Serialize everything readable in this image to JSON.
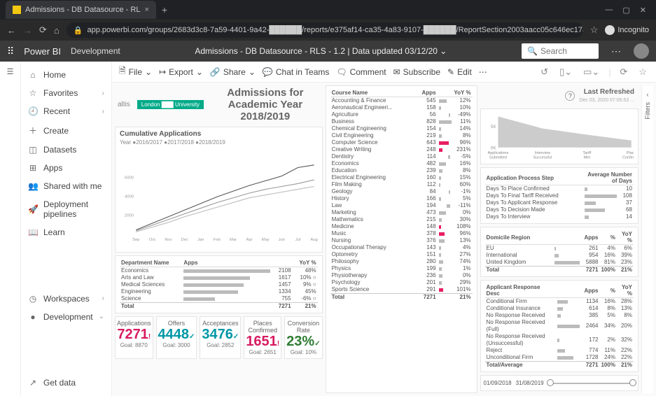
{
  "browser": {
    "tab_title": "Admissions - DB Datasource - RL",
    "url": "app.powerbi.com/groups/2683d3c8-7a59-4401-9a42-██████/reports/e375af14-ca35-4a83-9107-██████/ReportSection2003aacc05c646ec17aa",
    "incognito": "Incognito"
  },
  "pbi": {
    "brand": "Power BI",
    "env": "Development",
    "center": "Admissions - DB Datasource - RLS - 1.2  |  Data updated 03/12/20 ⌄",
    "search_ph": "Search"
  },
  "leftnav": {
    "home": "Home",
    "favorites": "Favorites",
    "recent": "Recent",
    "create": "Create",
    "datasets": "Datasets",
    "apps": "Apps",
    "shared": "Shared with me",
    "pipelines": "Deployment pipelines",
    "learn": "Learn",
    "workspaces": "Workspaces",
    "development": "Development",
    "getdata": "Get data"
  },
  "actionbar": {
    "file": "File",
    "export": "Export",
    "share": "Share",
    "chat": "Chat in Teams",
    "comment": "Comment",
    "subscribe": "Subscribe",
    "edit": "Edit"
  },
  "report": {
    "logo1": "altis",
    "logo2": "London ███ University",
    "title": "Admissions for Academic Year 2018/2019",
    "refresh_label": "Last Refreshed",
    "refresh_time": "Dec 03, 2020 07:05:53 ..."
  },
  "chart_data": {
    "cumulative": {
      "title": "Cumulative Applications",
      "legend": "Year  ●2016/2017  ●2017/2018  ●2018/2019",
      "type": "line",
      "categories": [
        "Sep",
        "Oct",
        "Nov",
        "Dec",
        "Jan",
        "Feb",
        "Mar",
        "Apr",
        "May",
        "Jun",
        "Jul",
        "Aug"
      ],
      "ylim": [
        0,
        8000
      ],
      "yticks": [
        2000,
        4000,
        6000
      ],
      "series": [
        {
          "name": "2016/2017",
          "values": [
            200,
            700,
            1200,
            1800,
            2300,
            2800,
            3300,
            3800,
            4100,
            4400,
            4700,
            5000
          ]
        },
        {
          "name": "2017/2018",
          "values": [
            300,
            900,
            1500,
            2100,
            2700,
            3300,
            3800,
            4300,
            4700,
            5000,
            5300,
            5700
          ]
        },
        {
          "name": "2018/2019",
          "values": [
            400,
            1100,
            1800,
            2500,
            3200,
            3900,
            4500,
            5100,
            5600,
            6100,
            7000,
            7271
          ]
        }
      ]
    },
    "funnel": {
      "type": "area",
      "categories": [
        "Applications Submitted",
        "Interview Successful",
        "Tariff Met",
        "Place Confirmed"
      ],
      "values": [
        7271,
        4448,
        3000,
        1651
      ],
      "yticks": [
        0,
        5000
      ],
      "yticklabels": [
        "0K",
        "5K"
      ]
    }
  },
  "dept": {
    "title": "Department Name",
    "col_apps": "Apps",
    "col_yoy": "YoY %",
    "rows": [
      {
        "name": "Economics",
        "apps": 2108,
        "yoy": "48%"
      },
      {
        "name": "Arts and Law",
        "apps": 1617,
        "yoy": "10% ○"
      },
      {
        "name": "Medical Sciences",
        "apps": 1457,
        "yoy": "9% ○"
      },
      {
        "name": "Engineering",
        "apps": 1334,
        "yoy": "45%"
      },
      {
        "name": "Science",
        "apps": 755,
        "yoy": "-6% ○"
      }
    ],
    "total": {
      "name": "Total",
      "apps": 7271,
      "yoy": "21%"
    }
  },
  "course": {
    "title": "Course Name",
    "col_apps": "Apps",
    "col_yoy": "YoY %",
    "rows": [
      {
        "name": "Accounting & Finance",
        "apps": 545,
        "yoy": "12%"
      },
      {
        "name": "Aeronautical Engineeri...",
        "apps": 158,
        "yoy": "10%"
      },
      {
        "name": "Agriculture",
        "apps": 56,
        "yoy": "-49%"
      },
      {
        "name": "Business",
        "apps": 828,
        "yoy": "11%"
      },
      {
        "name": "Chemical Engineering",
        "apps": 154,
        "yoy": "14%"
      },
      {
        "name": "Civil Engineering",
        "apps": 219,
        "yoy": "8%"
      },
      {
        "name": "Computer Science",
        "apps": 643,
        "yoy": "96%"
      },
      {
        "name": "Creative Writing",
        "apps": 248,
        "yoy": "231%"
      },
      {
        "name": "Dentistry",
        "apps": 114,
        "yoy": "-5%"
      },
      {
        "name": "Economics",
        "apps": 482,
        "yoy": "16%"
      },
      {
        "name": "Education",
        "apps": 239,
        "yoy": "8%"
      },
      {
        "name": "Electrical Engineering",
        "apps": 160,
        "yoy": "15%"
      },
      {
        "name": "Film Making",
        "apps": 112,
        "yoy": "60%"
      },
      {
        "name": "Geology",
        "apps": 84,
        "yoy": "-1%"
      },
      {
        "name": "History",
        "apps": 166,
        "yoy": "5%"
      },
      {
        "name": "Law",
        "apps": 194,
        "yoy": "-11%"
      },
      {
        "name": "Marketing",
        "apps": 473,
        "yoy": "0%"
      },
      {
        "name": "Mathematics",
        "apps": 215,
        "yoy": "30%"
      },
      {
        "name": "Medicine",
        "apps": 148,
        "yoy": "108%"
      },
      {
        "name": "Music",
        "apps": 378,
        "yoy": "96%"
      },
      {
        "name": "Nursing",
        "apps": 376,
        "yoy": "13%"
      },
      {
        "name": "Occupational Therapy",
        "apps": 143,
        "yoy": "4%"
      },
      {
        "name": "Optometry",
        "apps": 151,
        "yoy": "27%"
      },
      {
        "name": "Philosophy",
        "apps": 280,
        "yoy": "74%"
      },
      {
        "name": "Physics",
        "apps": 199,
        "yoy": "1%"
      },
      {
        "name": "Physiotherapy",
        "apps": 236,
        "yoy": "0%"
      },
      {
        "name": "Psychology",
        "apps": 201,
        "yoy": "29%"
      },
      {
        "name": "Sports Science",
        "apps": 291,
        "yoy": "101%"
      }
    ],
    "total": {
      "name": "Total",
      "apps": 7271,
      "yoy": "21%"
    }
  },
  "process": {
    "title": "Application Process Step",
    "col2": "Average Number of Days",
    "rows": [
      {
        "name": "Days To Place Confirmed",
        "v": 10
      },
      {
        "name": "Days To Final Tariff Received",
        "v": 108
      },
      {
        "name": "Days To Applicant Response",
        "v": 37
      },
      {
        "name": "Days To Decision Made",
        "v": 68
      },
      {
        "name": "Days To Interview",
        "v": 14
      }
    ]
  },
  "domicile": {
    "title": "Domicile Region",
    "col_apps": "Apps",
    "col_pct": "%",
    "col_yoy": "YoY %",
    "rows": [
      {
        "name": "EU",
        "apps": 261,
        "pct": "4%",
        "yoy": "6%"
      },
      {
        "name": "International",
        "apps": 954,
        "pct": "16%",
        "yoy": "39%"
      },
      {
        "name": "United Kingdom",
        "apps": 5888,
        "pct": "81%",
        "yoy": "23%"
      }
    ],
    "total": {
      "name": "Total",
      "apps": 7271,
      "pct": "100%",
      "yoy": "21%"
    }
  },
  "response": {
    "title": "Applicant Response Desc",
    "col_apps": "Apps",
    "col_pct": "%",
    "col_yoy": "YoY %",
    "rows": [
      {
        "name": "Conditional Firm",
        "apps": 1134,
        "pct": "16%",
        "yoy": "28%"
      },
      {
        "name": "Conditional Insurance",
        "apps": 614,
        "pct": "8%",
        "yoy": "13%"
      },
      {
        "name": "No Response Received",
        "apps": 385,
        "pct": "5%",
        "yoy": "8%"
      },
      {
        "name": "No Response Received (Full)",
        "apps": 2464,
        "pct": "34%",
        "yoy": "20%"
      },
      {
        "name": "No Response Received (Unsuccessful)",
        "apps": 172,
        "pct": "2%",
        "yoy": "32%"
      },
      {
        "name": "Reject",
        "apps": 774,
        "pct": "11%",
        "yoy": "22%"
      },
      {
        "name": "Unconditional Firm",
        "apps": 1728,
        "pct": "24%",
        "yoy": "22%"
      }
    ],
    "total": {
      "name": "Total/Average",
      "apps": 7271,
      "pct": "100%",
      "yoy": "21%"
    }
  },
  "kpis": [
    {
      "label": "Applications",
      "value": "7271",
      "goal": "Goal: 8870",
      "cls": "k-red",
      "tick": "!"
    },
    {
      "label": "Offers",
      "value": "4448",
      "goal": "Goal: 3000",
      "cls": "k-teal",
      "tick": "✓"
    },
    {
      "label": "Acceptances",
      "value": "3476",
      "goal": "Goal: 2852",
      "cls": "k-teal",
      "tick": "✓"
    },
    {
      "label": "Places Confirmed",
      "value": "1651",
      "goal": "Goal: 2651",
      "cls": "k-red",
      "tick": "!"
    },
    {
      "label": "Conversion Rate",
      "value": "23%",
      "goal": "Goal: 10%",
      "cls": "k-green",
      "tick": "✓"
    }
  ],
  "slider": {
    "from": "01/09/2018",
    "to": "31/08/2019"
  },
  "filters": "Filters"
}
